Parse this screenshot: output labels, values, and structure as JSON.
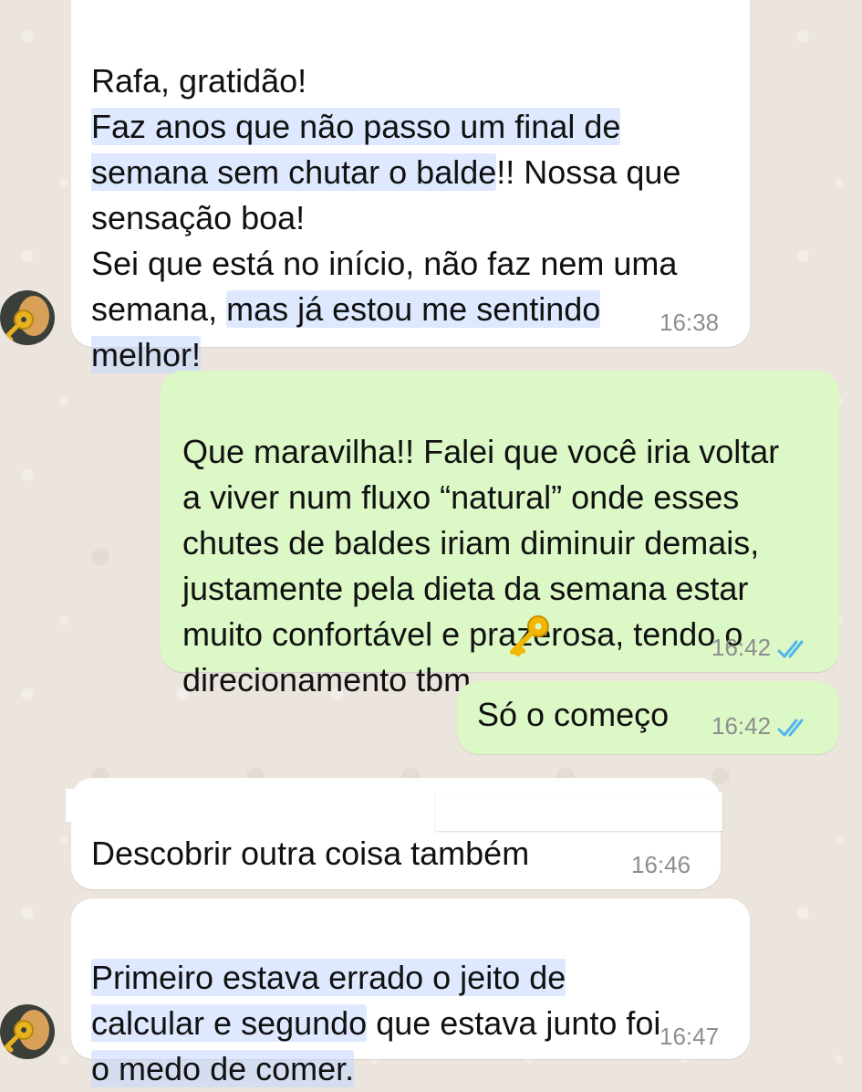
{
  "messages": [
    {
      "id": "m1",
      "direction": "incoming",
      "segments": [
        {
          "text": "Rafa, gratidão!\n",
          "hl": false
        },
        {
          "text": "Faz anos que não passo um final de\nsemana sem chutar o balde",
          "hl": true
        },
        {
          "text": "!! Nossa que\nsensação boa!\nSei que está no início, não faz nem uma\nsemana, ",
          "hl": false
        },
        {
          "text": "mas já estou me sentindo\nmelhor!",
          "hl": true
        }
      ],
      "time": "16:38"
    },
    {
      "id": "m2",
      "direction": "outgoing",
      "text": "Que maravilha!! Falei que você iria voltar\na viver num fluxo “natural” onde esses\nchutes de baldes iriam diminuir demais,\njustamente pela dieta da semana estar\nmuito confortável e prazerosa, tendo o\ndirecionamento tbm",
      "emoji": "key",
      "time": "16:42",
      "status": "read"
    },
    {
      "id": "m3",
      "direction": "outgoing",
      "text": "Só o começo",
      "time": "16:42",
      "status": "read"
    },
    {
      "id": "m4",
      "direction": "incoming",
      "text": "Descobrir outra coisa também",
      "time": "16:46"
    },
    {
      "id": "m5",
      "direction": "incoming",
      "segments": [
        {
          "text": "Primeiro estava errado o jeito de\ncalcular e segundo",
          "hl": true
        },
        {
          "text": " que estava junto foi\n",
          "hl": false
        },
        {
          "text": "o medo de comer.",
          "hl": true
        }
      ],
      "time": "16:47"
    }
  ],
  "colors": {
    "background": "#ece5dd",
    "incoming_bubble": "#ffffff",
    "outgoing_bubble": "#dcf8c6",
    "read_ticks": "#4fb6ec",
    "timestamp": "#8e8e8e",
    "highlight": "#c3d7ff"
  },
  "icons": {
    "avatar": "contact-avatar",
    "emoji": "key-emoji",
    "status": "double-check-icon"
  }
}
